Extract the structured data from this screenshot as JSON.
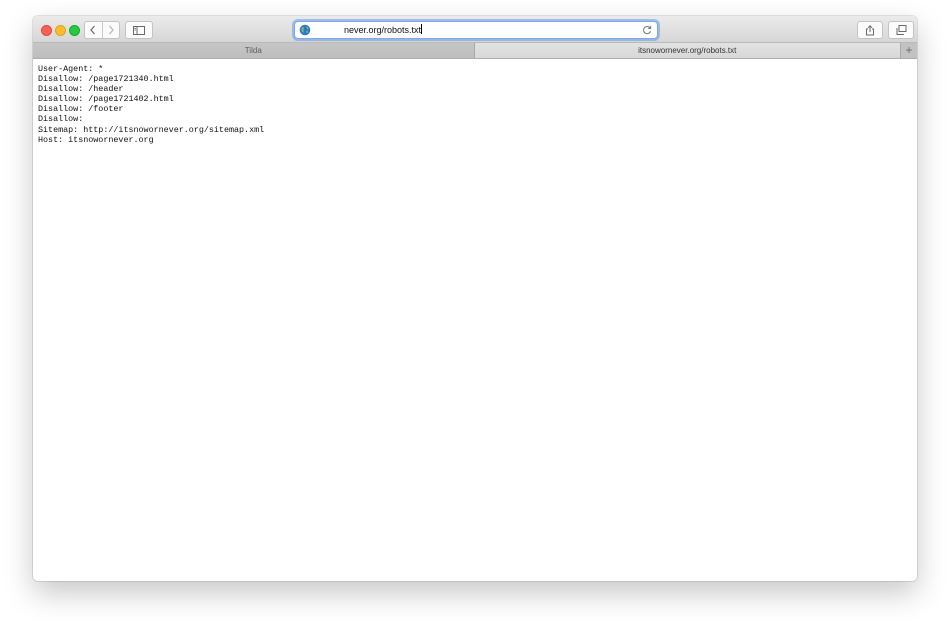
{
  "address_bar": {
    "url": "never.org/robots.txt"
  },
  "tabs": [
    {
      "label": "Tilda",
      "active": false
    },
    {
      "label": "itsnowornever.org/robots.txt",
      "active": true
    }
  ],
  "new_tab_label": "+",
  "page": {
    "lines": [
      "User-Agent: *",
      "Disallow: /page1721340.html",
      "Disallow: /header",
      "Disallow: /page1721402.html",
      "Disallow: /footer",
      "Disallow:",
      "Sitemap: http://itsnowornever.org/sitemap.xml",
      "Host: itsnowornever.org"
    ]
  },
  "colors": {
    "close": "#ff5f57",
    "minimize": "#ffbd2e",
    "maximize": "#28c940",
    "address_focus": "#629ae7"
  },
  "icons": [
    "close-icon",
    "minimize-icon",
    "maximize-icon",
    "back-icon",
    "forward-icon",
    "sidebar-icon",
    "globe-icon",
    "reload-icon",
    "share-icon",
    "tabs-overview-icon"
  ]
}
